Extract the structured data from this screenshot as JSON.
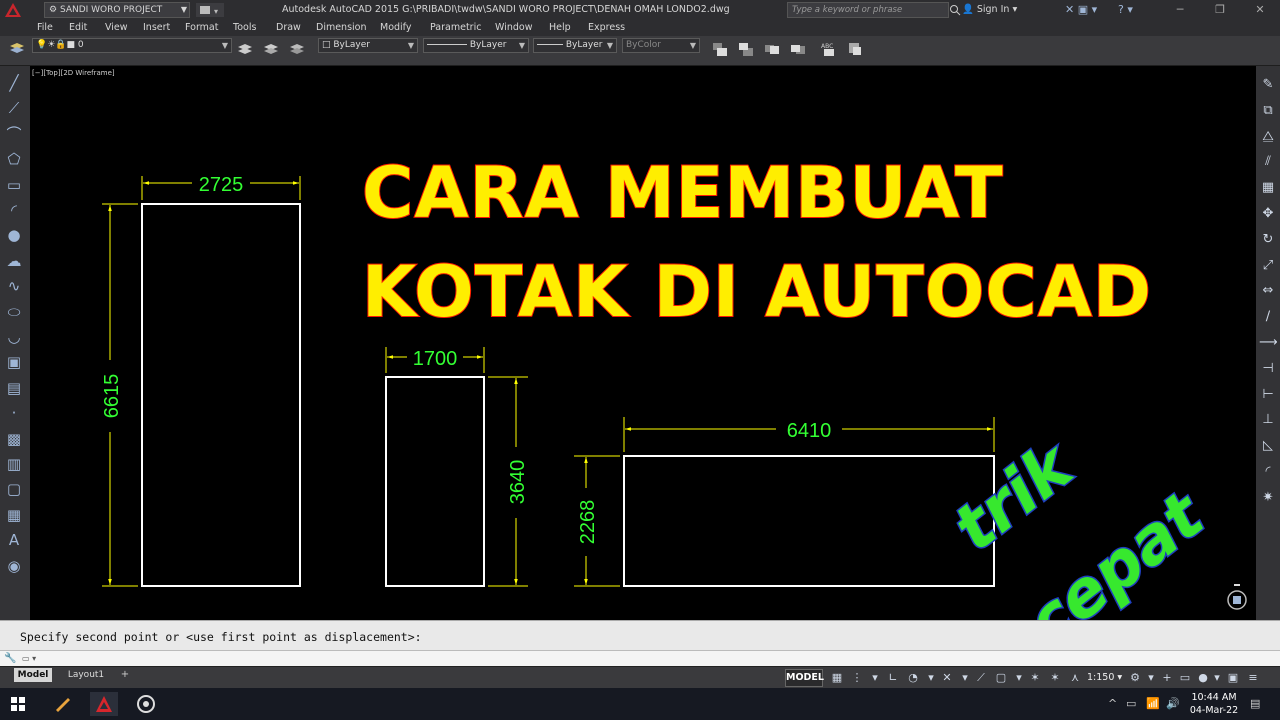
{
  "title_bar": {
    "workspace": "SANDI WORO PROJECT",
    "app_title": "Autodesk AutoCAD 2015    G:\\PRIBADI\\twdw\\SANDI WORO PROJECT\\DENAH OMAH LONDO2.dwg",
    "search_placeholder": "Type a keyword or phrase",
    "sign_in": "Sign In"
  },
  "menu": [
    "File",
    "Edit",
    "View",
    "Insert",
    "Format",
    "Tools",
    "Draw",
    "Dimension",
    "Modify",
    "Parametric",
    "Window",
    "Help",
    "Express"
  ],
  "toolbar": {
    "layer": "0",
    "color": "ByLayer",
    "linetype": "ByLayer",
    "lineweight": "ByLayer",
    "plotstyle": "ByColor"
  },
  "viewport": {
    "label": "[−][Top][2D Wireframe]"
  },
  "drawing": {
    "dims": {
      "rect1_width": "2725",
      "rect1_height": "6615",
      "rect2_width": "1700",
      "rect2_height": "3640",
      "rect3_width": "6410",
      "rect3_height": "2268"
    }
  },
  "overlay": {
    "headline_line1": "CARA MEMBUAT",
    "headline_line2": "KOTAK DI AUTOCAD",
    "badge_line1": "trik",
    "badge_line2": "cepat"
  },
  "command": {
    "history": "Specify second point or <use first point as displacement>:"
  },
  "layout_tabs": [
    "Model",
    "Layout1"
  ],
  "status": {
    "model": "MODEL",
    "scale": "1:150"
  },
  "taskbar": {
    "time": "10:44 AM",
    "date": "04-Mar-22"
  },
  "colors": {
    "headline_fill": "#ffee00",
    "headline_stroke": "#ff1a00",
    "badge_fill": "#37e82e",
    "badge_stroke": "#1e3fbf",
    "dimension_text": "#33ff33",
    "dimension_line": "#ffff00",
    "object_line": "#ffffff"
  }
}
